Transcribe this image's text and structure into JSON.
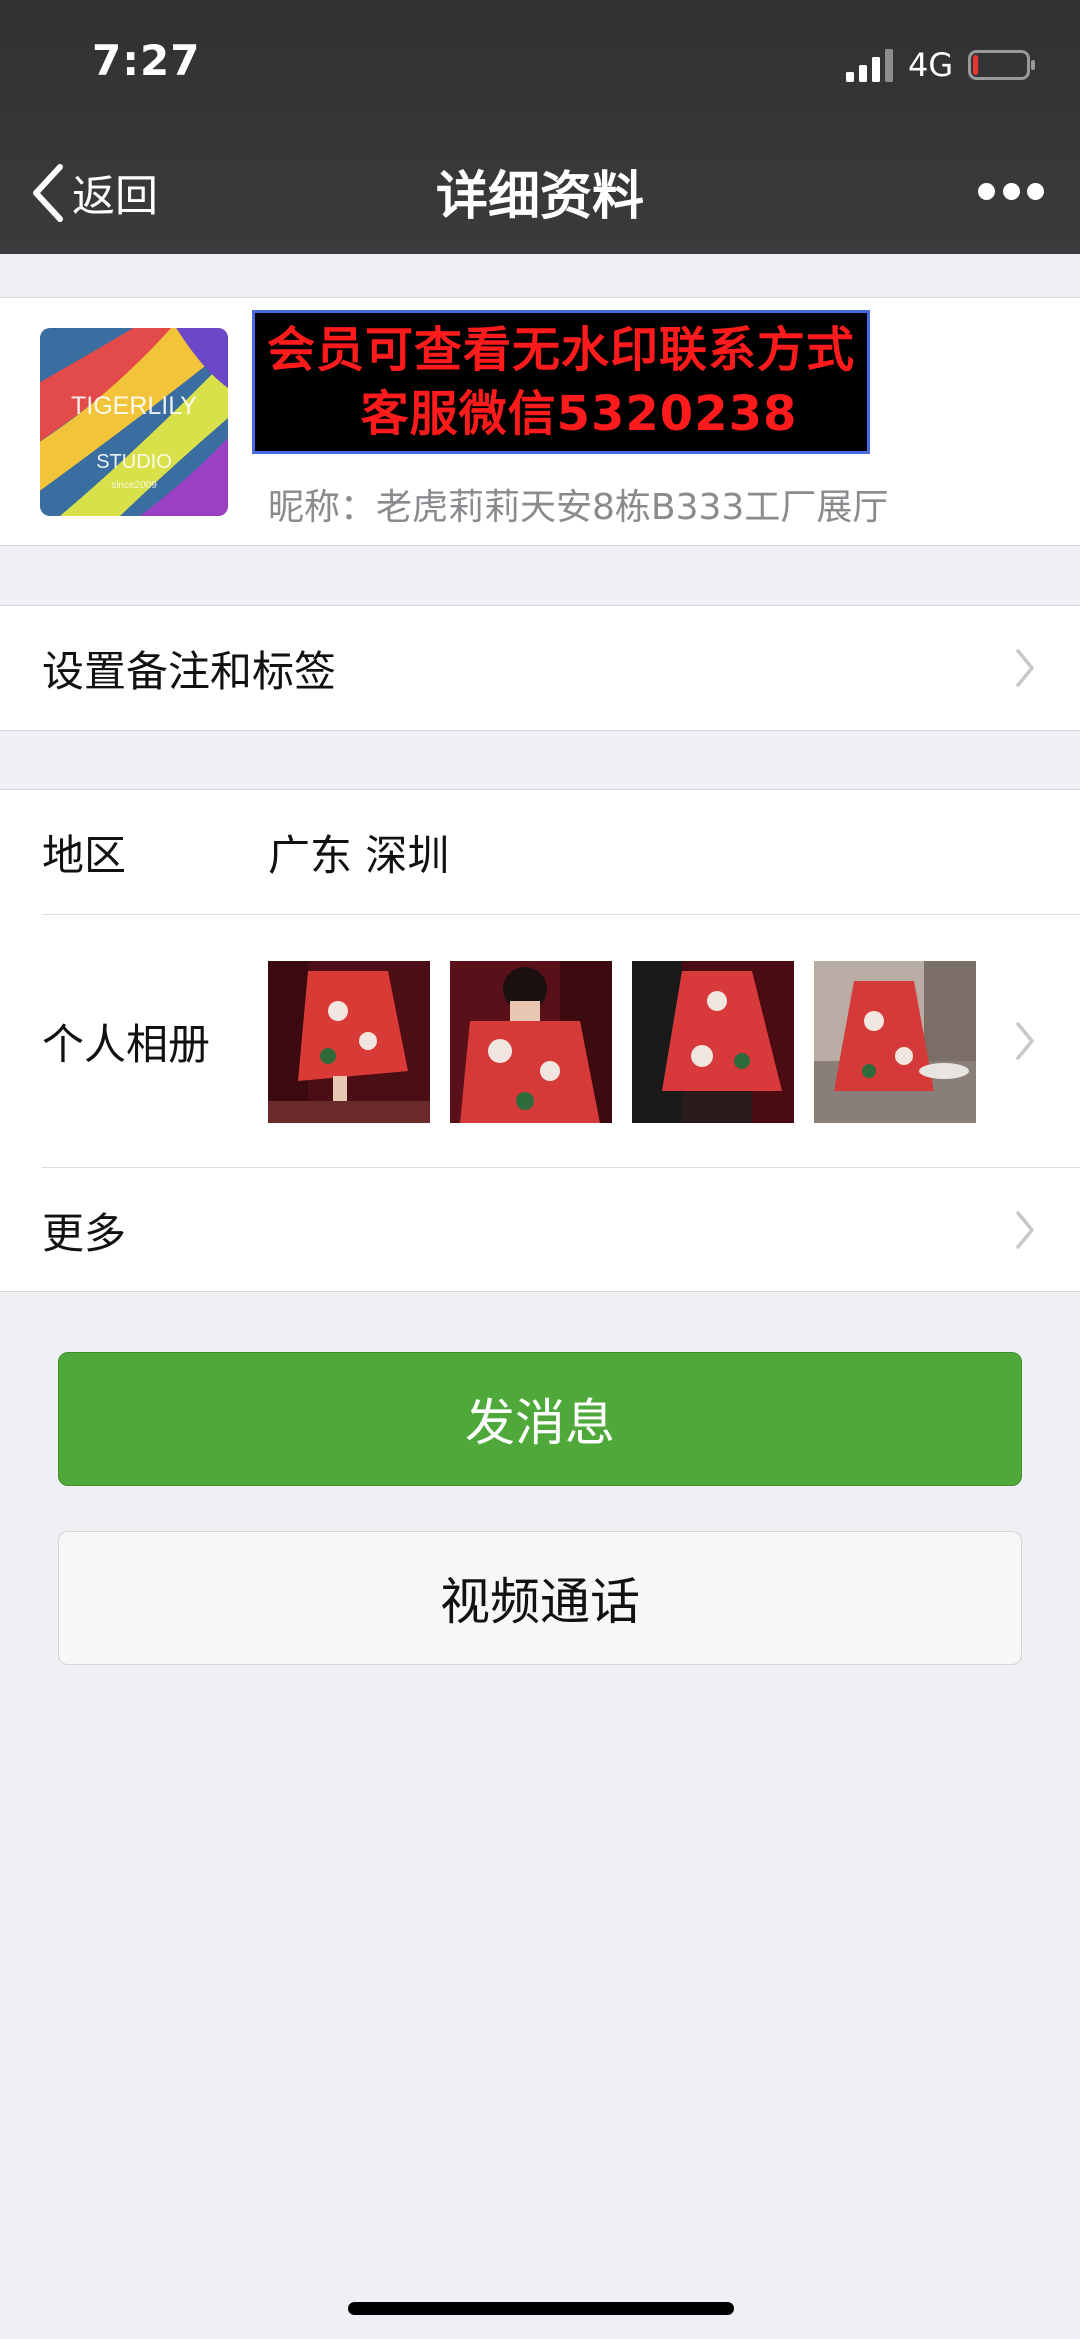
{
  "status_bar": {
    "time": "7:27",
    "network": "4G",
    "battery_level": 0.1,
    "battery_color": "#e8362e"
  },
  "nav": {
    "back_label": "返回",
    "title": "详细资料"
  },
  "profile": {
    "avatar_text": "TIGERLILY",
    "avatar_subtext": "STUDIO",
    "avatar_since": "since2009",
    "watermark_line1": "会员可查看无水印联系方式",
    "watermark_line2": "客服微信5320238",
    "nickname": "昵称：老虎莉莉天安8栋B333工厂展厅"
  },
  "remark": {
    "label": "设置备注和标签"
  },
  "info": {
    "region_label": "地区",
    "region_value": "广东 深圳",
    "album_label": "个人相册",
    "album_photos": [
      "dress-photo-1",
      "dress-photo-2",
      "dress-photo-3",
      "dress-photo-4"
    ],
    "more_label": "更多"
  },
  "actions": {
    "send_message": "发消息",
    "video_call": "视频通话"
  },
  "colors": {
    "nav_bg": "#333436",
    "primary_button": "#4ea93a",
    "page_bg": "#efeff4",
    "watermark_text": "#ff1b1b"
  }
}
